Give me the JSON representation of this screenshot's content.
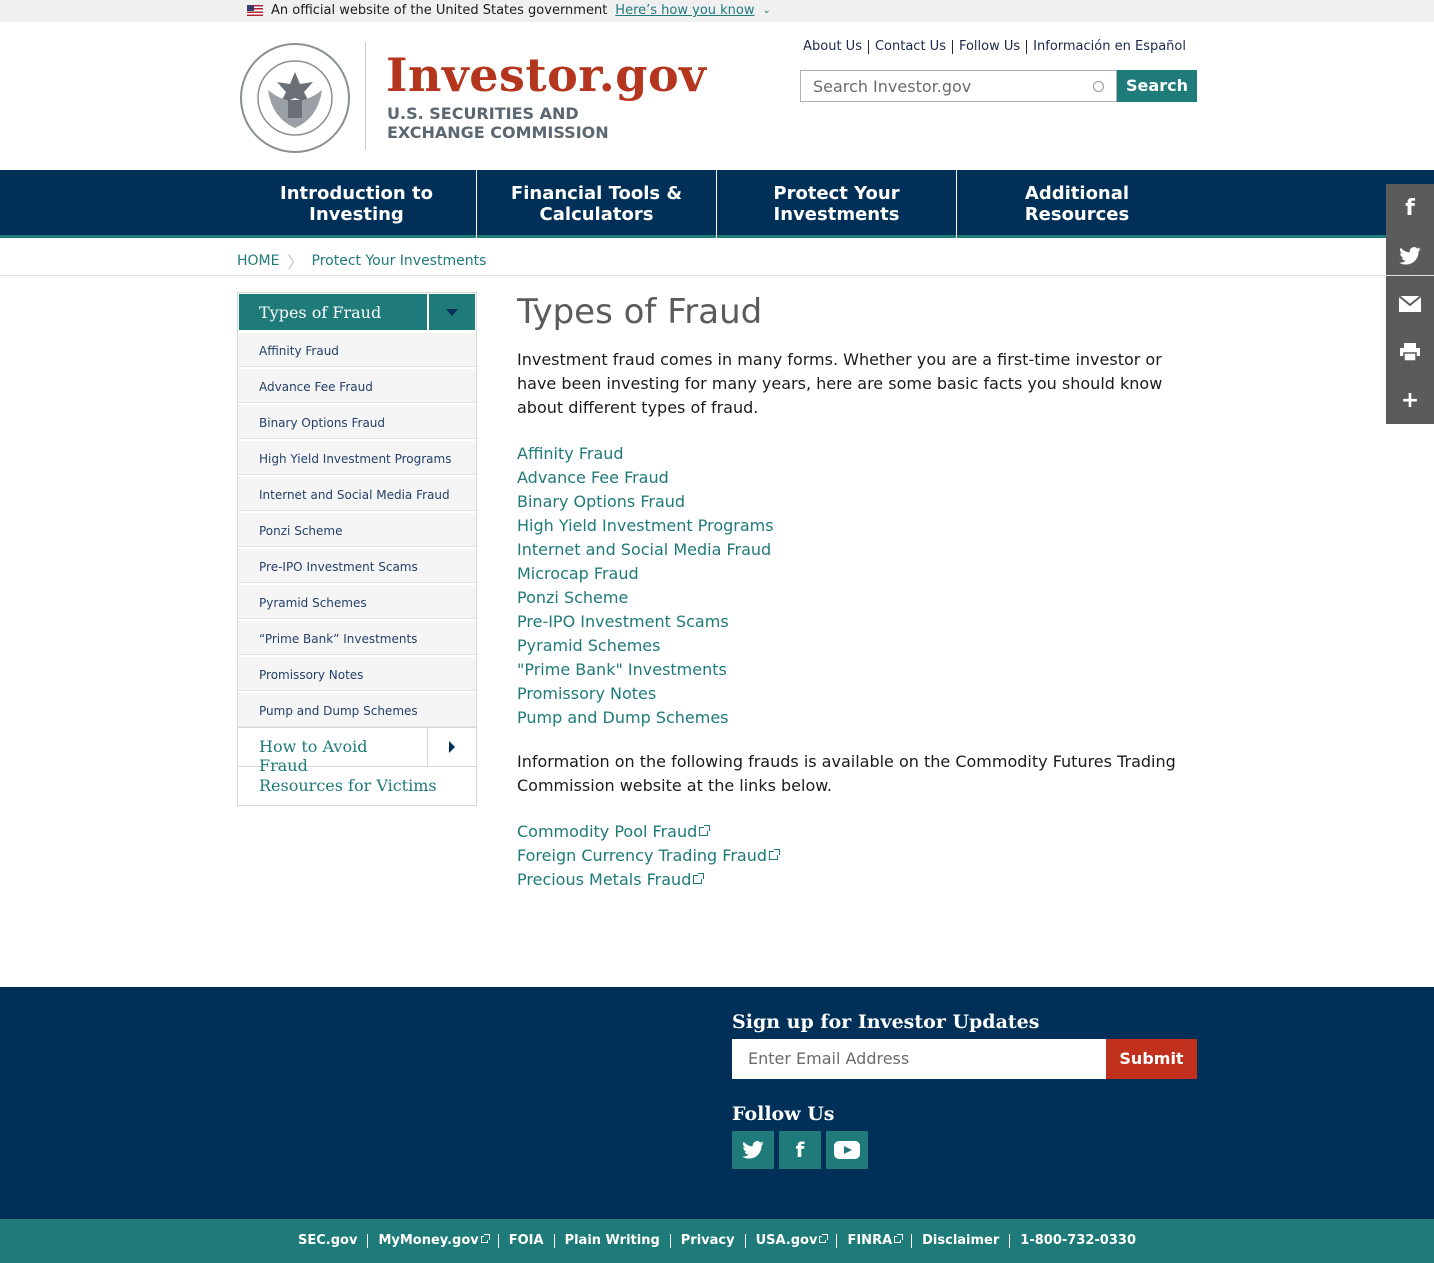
{
  "gov_banner": {
    "text": "An official website of the United States government",
    "howto": "Here’s how you know"
  },
  "header": {
    "site_title": "Investor.gov",
    "agency_line1": "U.S. SECURITIES AND",
    "agency_line2": "EXCHANGE COMMISSION",
    "seal_text": "U.S. SECURITIES AND EXCHANGE COMMISSION · MCMXXXIV",
    "util_links": [
      "About Us",
      "Contact Us",
      "Follow Us",
      "Información en Español"
    ],
    "search_placeholder": "Search Investor.gov",
    "search_button": "Search"
  },
  "nav": {
    "items": [
      [
        "Introduction to",
        "Investing"
      ],
      [
        "Financial Tools &",
        "Calculators"
      ],
      [
        "Protect Your",
        "Investments"
      ],
      [
        "Additional",
        "Resources"
      ]
    ]
  },
  "share_rail": {
    "icons": [
      "facebook-icon",
      "twitter-icon",
      "email-icon",
      "print-icon",
      "plus-icon"
    ]
  },
  "breadcrumb": {
    "home": "HOME",
    "current": "Protect Your Investments"
  },
  "sidenav": {
    "heading": "Types of Fraud",
    "sub_items": [
      "Affinity Fraud",
      "Advance Fee Fraud",
      "Binary Options Fraud",
      "High Yield Investment Programs",
      "Internet and Social Media Fraud",
      "Ponzi Scheme",
      "Pre-IPO Investment Scams",
      "Pyramid Schemes",
      "“Prime Bank” Investments",
      "Promissory Notes",
      "Pump and Dump Schemes"
    ],
    "how_to_avoid": "How to Avoid Fraud",
    "resources": "Resources for Victims"
  },
  "main": {
    "title": "Types of Fraud",
    "intro": "Investment fraud comes in many forms. Whether you are a first-time investor or have been investing for many years, here are some basic facts you should know about different types of fraud.",
    "links": [
      "Affinity Fraud",
      "Advance Fee Fraud",
      "Binary Options Fraud",
      "High Yield Investment Programs",
      "Internet and Social Media Fraud",
      "Microcap Fraud",
      "Ponzi Scheme",
      "Pre-IPO Investment Scams",
      "Pyramid Schemes",
      "\"Prime Bank\" Investments",
      "Promissory Notes",
      "Pump and Dump Schemes"
    ],
    "cftc_text": "Information on the following frauds is available on the Commodity Futures Trading Commission website at the links below.",
    "cftc_links": [
      "Commodity Pool Fraud",
      "Foreign Currency Trading Fraud",
      "Precious Metals Fraud"
    ]
  },
  "footer": {
    "signup_title": "Sign up for Investor Updates",
    "email_placeholder": "Enter Email Address",
    "submit": "Submit",
    "follow_title": "Follow Us",
    "social_icons": [
      "twitter-icon",
      "facebook-icon",
      "youtube-icon"
    ]
  },
  "bottom_links": [
    {
      "label": "SEC.gov",
      "external": false
    },
    {
      "label": "MyMoney.gov",
      "external": true
    },
    {
      "label": "FOIA",
      "external": false
    },
    {
      "label": "Plain Writing",
      "external": false
    },
    {
      "label": "Privacy",
      "external": false
    },
    {
      "label": "USA.gov",
      "external": true
    },
    {
      "label": "FINRA",
      "external": true
    },
    {
      "label": "Disclaimer",
      "external": false
    },
    {
      "label": "1-800-732-0330",
      "external": false
    }
  ],
  "colors": {
    "navy": "#003057",
    "teal": "#1f7a7a",
    "brand_red": "#b5361f",
    "submit_red": "#c0301d"
  }
}
